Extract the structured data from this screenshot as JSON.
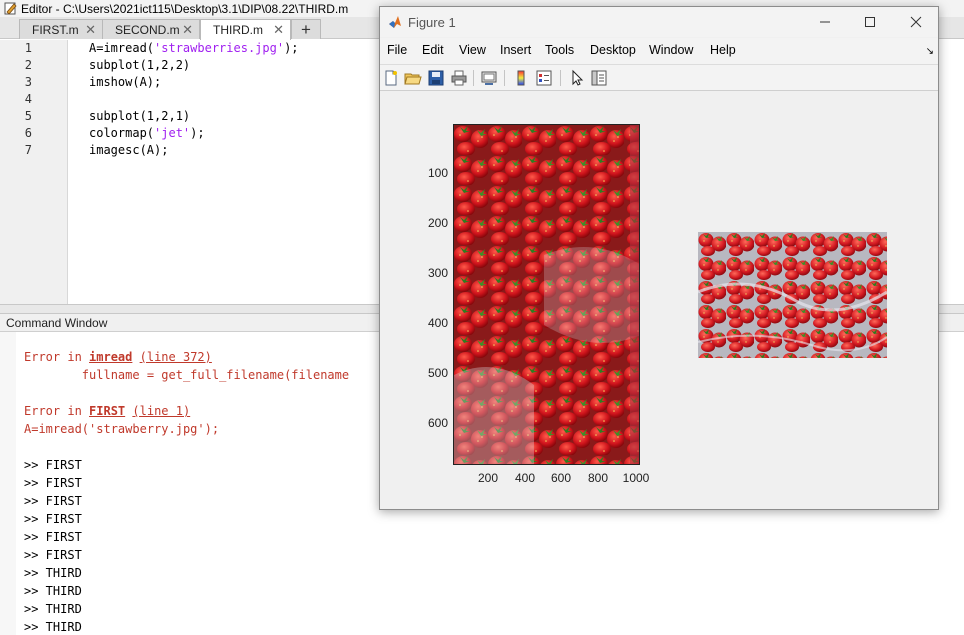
{
  "editor": {
    "title": "Editor - C:\\Users\\2021ict115\\Desktop\\3.1\\DIP\\08.22\\THIRD.m",
    "tabs": [
      {
        "label": "FIRST.m",
        "close": "✕"
      },
      {
        "label": "SECOND.m",
        "close": "✕"
      },
      {
        "label": "THIRD.m",
        "close": "✕"
      }
    ],
    "add_tab": "+",
    "line_numbers": [
      "1",
      "2",
      "3",
      "4",
      "5",
      "6",
      "7"
    ],
    "code": {
      "l1_pre": "A=imread(",
      "l1_str": "'strawberries.jpg'",
      "l1_post": ");",
      "l2": "subplot(1,2,2)",
      "l3": "imshow(A);",
      "l5": "subplot(1,2,1)",
      "l6_pre": "colormap(",
      "l6_str": "'jet'",
      "l6_post": ");",
      "l7": "imagesc(A);"
    }
  },
  "command_window": {
    "title": "Command Window",
    "error1": {
      "prefix": "Error in ",
      "func": "imread",
      "sep": " ",
      "line": "(line 372)"
    },
    "error1_detail": "        fullname = get_full_filename(filename",
    "error2": {
      "prefix": "Error in ",
      "func": "FIRST",
      "sep": " ",
      "line": "(line 1)"
    },
    "error2_detail": "A=imread('strawberry.jpg');",
    "history": [
      ">> FIRST",
      ">> FIRST",
      ">> FIRST",
      ">> FIRST",
      ">> FIRST",
      ">> FIRST",
      ">> THIRD",
      ">> THIRD",
      ">> THIRD",
      ">> THIRD"
    ]
  },
  "figure": {
    "title": "Figure 1",
    "menu": [
      "File",
      "Edit",
      "View",
      "Insert",
      "Tools",
      "Desktop",
      "Window",
      "Help"
    ],
    "menu_corner": "↘",
    "toolbar_icons": [
      "new-figure-icon",
      "open-file-icon",
      "save-icon",
      "print-icon",
      "link-plot-icon",
      "colorbar-icon",
      "legend-icon",
      "pointer-icon",
      "property-inspector-icon"
    ],
    "axes_left": {
      "y_ticks": [
        "100",
        "200",
        "300",
        "400",
        "500",
        "600"
      ],
      "x_ticks": [
        "200",
        "400",
        "600",
        "800",
        "1000"
      ]
    }
  },
  "colors": {
    "error": "#c0392b",
    "string": "#a020f0",
    "strawberry_red": "#c8141e",
    "leaf_green": "#2f7d1f"
  }
}
